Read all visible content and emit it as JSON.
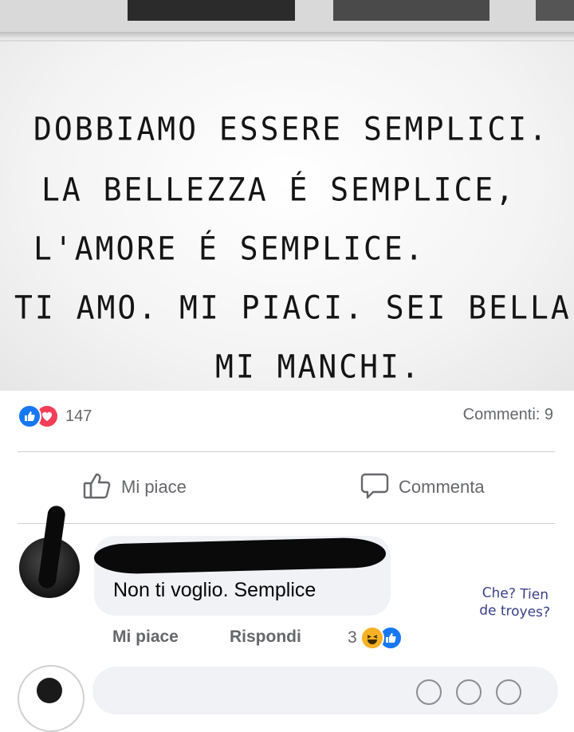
{
  "post": {
    "quote_lines": [
      "Dobbiamo essere semplici.",
      "La bellezza é semplice,",
      "l'amore é semplice.",
      "Ti amo. Mi piaci. Sei bella.",
      "Mi manchi."
    ],
    "reactions": {
      "count": "147",
      "types": [
        "like-icon",
        "love-icon"
      ]
    },
    "comments_count": "Commenti: 9"
  },
  "actions": {
    "like_label": "Mi piace",
    "comment_label": "Commenta"
  },
  "comment": {
    "text": "Non ti voglio. Semplice",
    "like_label": "Mi piace",
    "reply_label": "Rispondi",
    "reaction_count": "3",
    "reaction_types": [
      "haha-icon",
      "like-icon"
    ]
  },
  "annotation": {
    "line1": "Che? Tien",
    "line2": "de troyes?"
  },
  "colors": {
    "facebook_blue": "#1877f2",
    "love_red": "#f33e58",
    "haha_yellow": "#f7b125",
    "secondary_text": "#65676b",
    "annotation_ink": "#3a3f88"
  }
}
